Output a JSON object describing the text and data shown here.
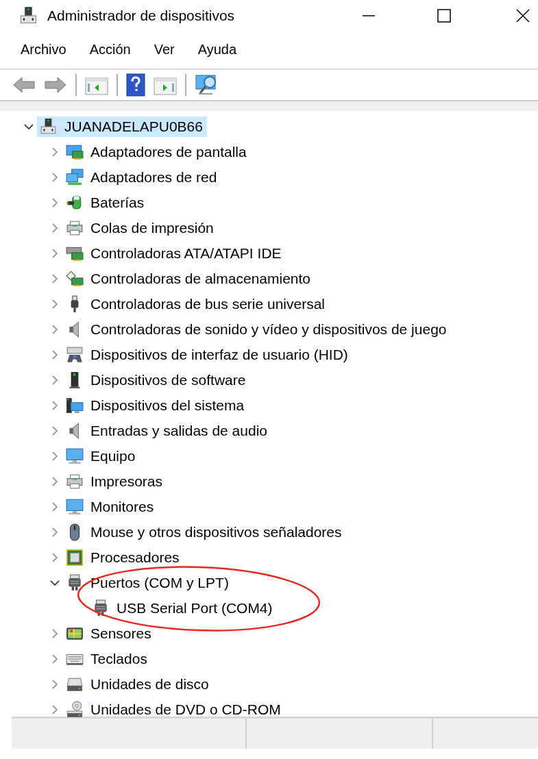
{
  "window": {
    "title": "Administrador de dispositivos"
  },
  "menu": [
    "Archivo",
    "Acción",
    "Ver",
    "Ayuda"
  ],
  "tree": [
    {
      "label": "JUANADELAPU0B66",
      "kind": "computer",
      "selected": true,
      "expanded": true,
      "children": [
        {
          "label": "Adaptadores de pantalla",
          "kind": "display",
          "selected": false,
          "expanded": false
        },
        {
          "label": "Adaptadores de red",
          "kind": "network",
          "selected": false,
          "expanded": false
        },
        {
          "label": "Baterías",
          "kind": "battery",
          "selected": false,
          "expanded": false
        },
        {
          "label": "Colas de impresión",
          "kind": "printer",
          "selected": false,
          "expanded": false
        },
        {
          "label": "Controladoras ATA/ATAPI IDE",
          "kind": "ide",
          "selected": false,
          "expanded": false
        },
        {
          "label": "Controladoras de almacenamiento",
          "kind": "storage",
          "selected": false,
          "expanded": false
        },
        {
          "label": "Controladoras de bus serie universal",
          "kind": "usb",
          "selected": false,
          "expanded": false
        },
        {
          "label": "Controladoras de sonido y vídeo y dispositivos de juego",
          "kind": "speaker",
          "selected": false,
          "expanded": false
        },
        {
          "label": "Dispositivos de interfaz de usuario (HID)",
          "kind": "hid",
          "selected": false,
          "expanded": false
        },
        {
          "label": "Dispositivos de software",
          "kind": "software",
          "selected": false,
          "expanded": false
        },
        {
          "label": "Dispositivos del sistema",
          "kind": "system",
          "selected": false,
          "expanded": false
        },
        {
          "label": "Entradas y salidas de audio",
          "kind": "speaker",
          "selected": false,
          "expanded": false
        },
        {
          "label": "Equipo",
          "kind": "monitor",
          "selected": false,
          "expanded": false
        },
        {
          "label": "Impresoras",
          "kind": "printer",
          "selected": false,
          "expanded": false
        },
        {
          "label": "Monitores",
          "kind": "monitor",
          "selected": false,
          "expanded": false
        },
        {
          "label": "Mouse y otros dispositivos señaladores",
          "kind": "mouse",
          "selected": false,
          "expanded": false
        },
        {
          "label": "Procesadores",
          "kind": "cpu",
          "selected": false,
          "expanded": false
        },
        {
          "label": "Puertos (COM y LPT)",
          "kind": "port",
          "selected": false,
          "expanded": true,
          "children": [
            {
              "label": "USB Serial Port (COM4)",
              "kind": "port",
              "selected": false
            }
          ]
        },
        {
          "label": "Sensores",
          "kind": "sensor",
          "selected": false,
          "expanded": false
        },
        {
          "label": "Teclados",
          "kind": "keyboard",
          "selected": false,
          "expanded": false
        },
        {
          "label": "Unidades de disco",
          "kind": "disk",
          "selected": false,
          "expanded": false
        },
        {
          "label": "Unidades de DVD o CD-ROM",
          "kind": "dvd",
          "selected": false,
          "expanded": false
        }
      ]
    }
  ]
}
